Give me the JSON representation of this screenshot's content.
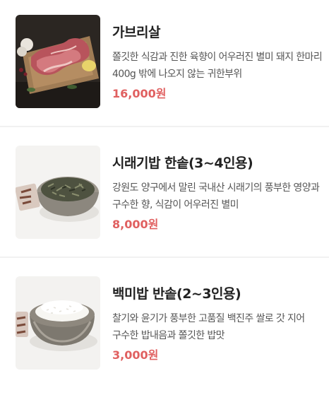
{
  "items": [
    {
      "title": "가브리살",
      "description": "쫄깃한 식감과 진한 육향이 어우러진 별미 돼지 한마리 400g 밖에 나오지 않는 귀한부위",
      "price": "16,000원",
      "image": "grilled-pork-photo"
    },
    {
      "title": "시래기밥 한솥(3~4인용)",
      "description": "강원도 양구에서 말린 국내산 시래기의 풍부한 영양과 구수한 향, 식감이 어우러진 별미",
      "price": "8,000원",
      "image": "siraegi-rice-bowl-photo"
    },
    {
      "title": "백미밥 반솥(2~3인용)",
      "description": "찰기와 윤기가 풍부한 고품질 백진주 쌀로 갓 지어 구수한 밥내음과 쫄깃한 밥맛",
      "price": "3,000원",
      "image": "white-rice-bowl-photo"
    }
  ],
  "colors": {
    "price": "#e06060",
    "title": "#222222",
    "description": "#555555",
    "divider": "#f1f1f1"
  }
}
